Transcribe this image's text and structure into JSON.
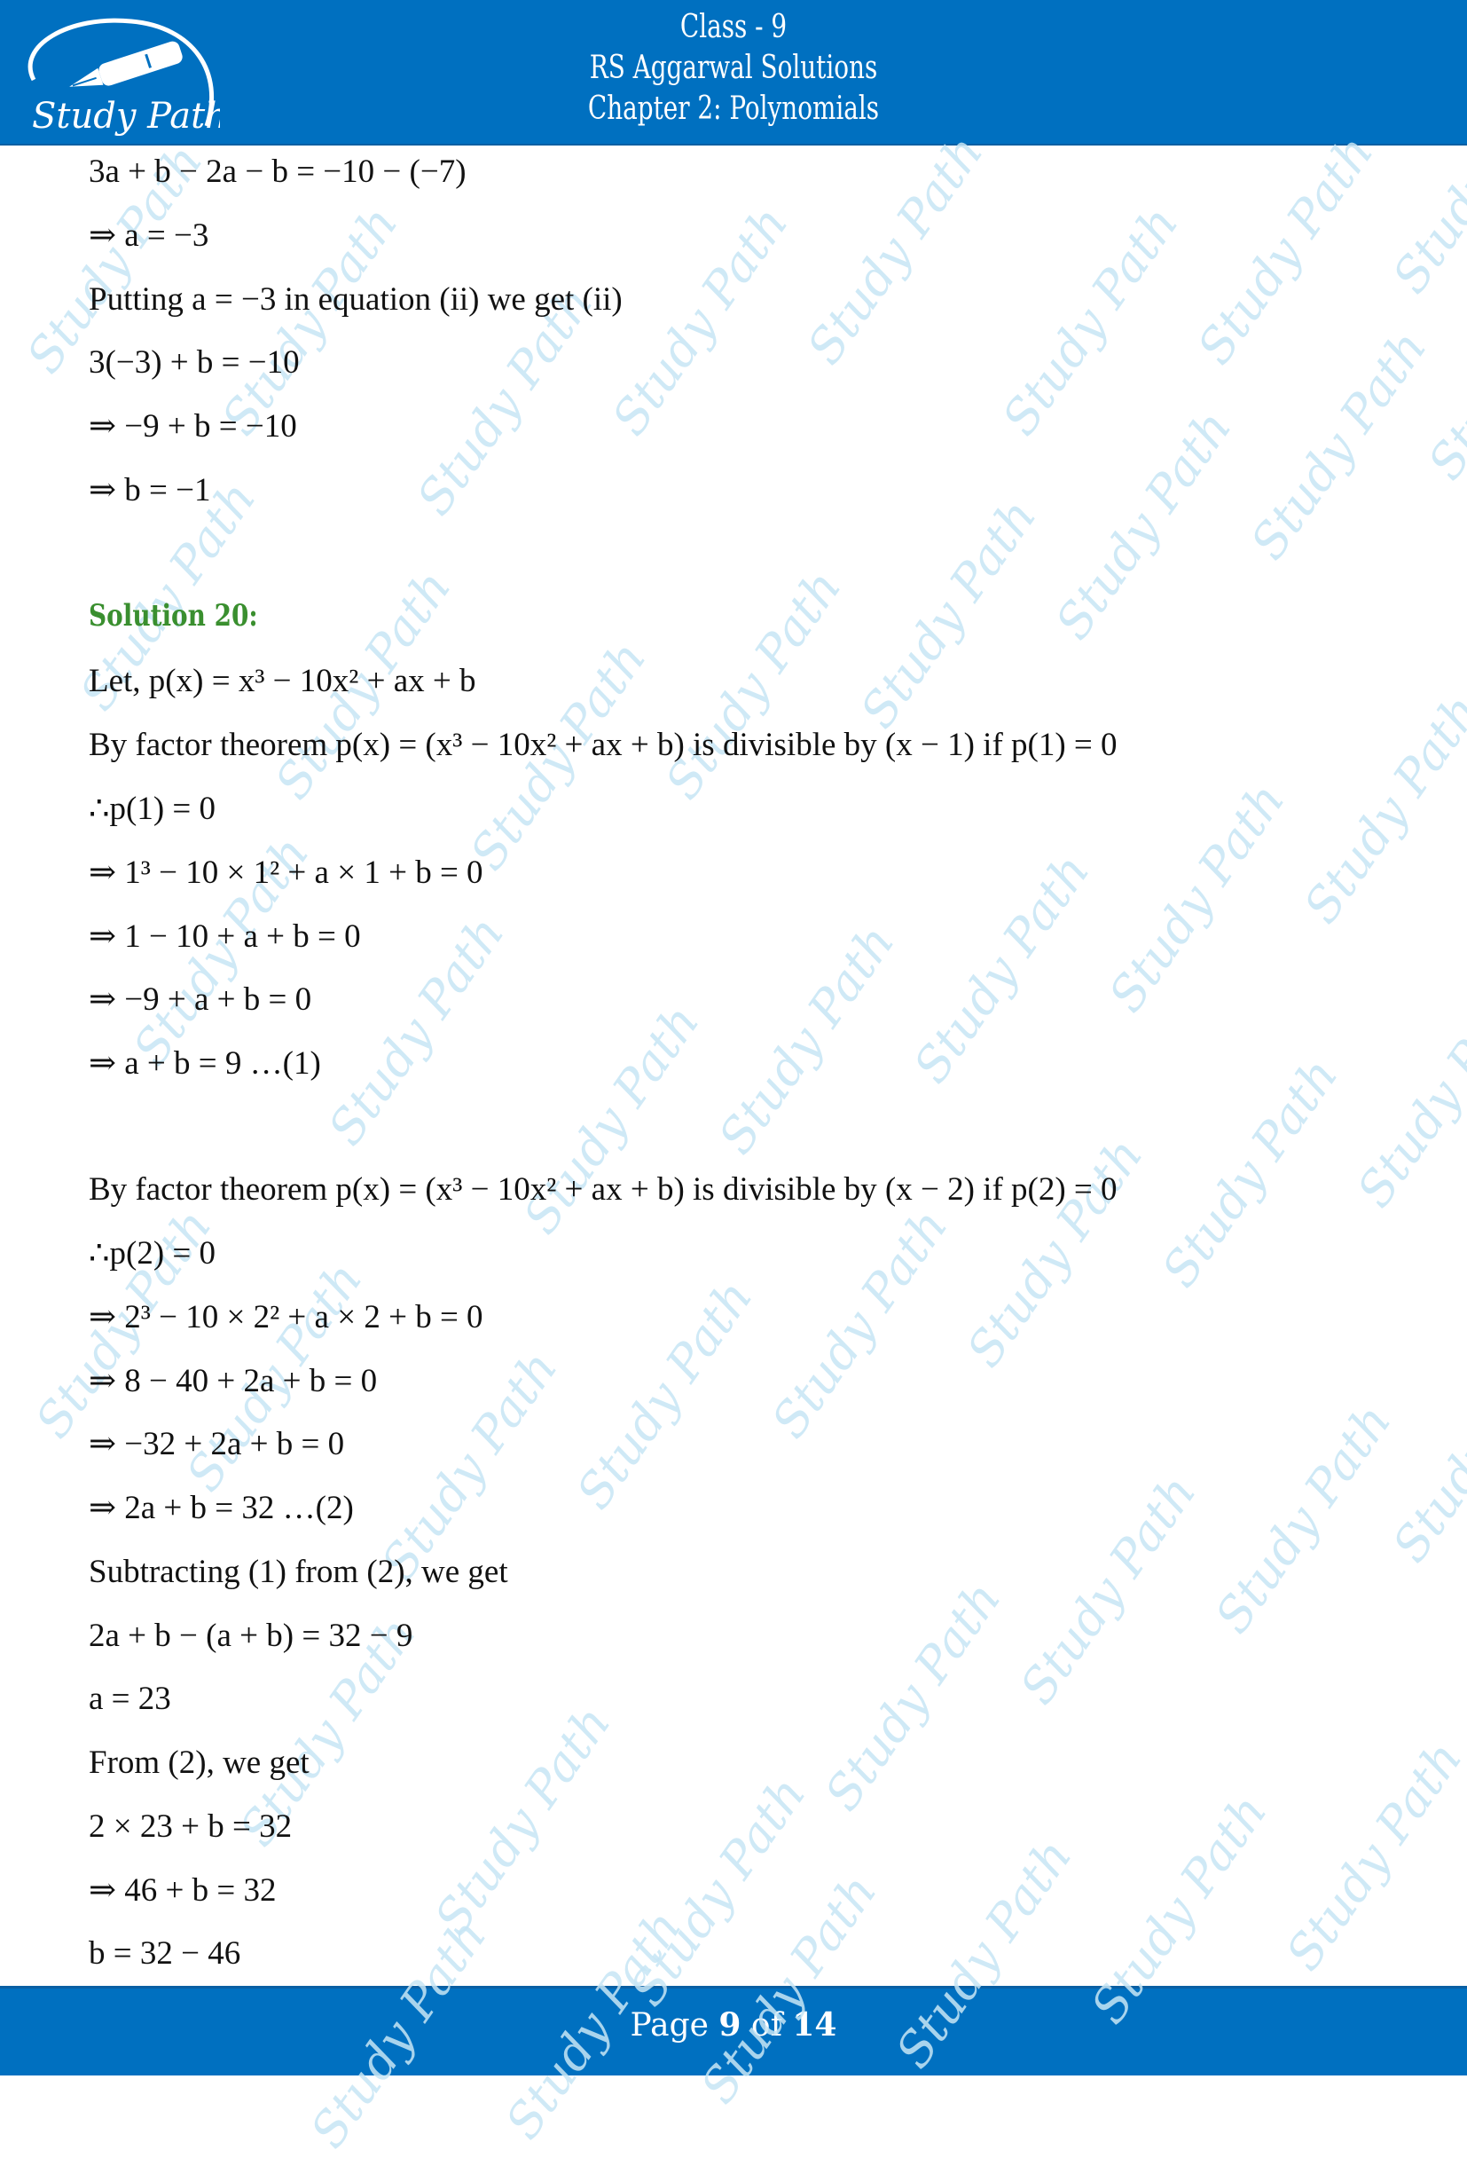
{
  "header": {
    "logo_text": "Study Path",
    "class_label": "Class - 9",
    "book_title": "RS Aggarwal Solutions",
    "chapter_title": "Chapter 2: Polynomials",
    "background_color": "#0070c0"
  },
  "watermark_text": "Study Path",
  "content": {
    "prev_solution_lines": [
      "3a + b − 2a − b = −10 − (−7)",
      "⇒ a = −3",
      "Putting a = −3 in equation (ii) we get (ii)",
      "3(−3) + b = −10",
      "⇒ −9 + b = −10",
      "⇒ b = −1"
    ],
    "solution_title": "Solution 20:",
    "solution_title_color": "#3a8f2f",
    "lines": [
      "Let, p(x) = x³ − 10x² + ax + b",
      "By factor theorem p(x) = (x³ − 10x² + ax + b) is divisible by (x − 1) if p(1) = 0",
      "∴p(1) = 0",
      "⇒ 1³ − 10 × 1² + a × 1 + b = 0",
      "⇒ 1 − 10 + a + b = 0",
      "⇒ −9 + a + b = 0",
      "⇒ a + b = 9        …(1)",
      "By factor theorem p(x) = (x³ − 10x² + ax + b) is divisible by (x − 2) if p(2) = 0",
      "∴p(2) = 0",
      "⇒ 2³ − 10 × 2² + a × 2 + b = 0",
      "⇒ 8 − 40 + 2a + b = 0",
      "⇒ −32 + 2a + b = 0",
      "⇒ 2a + b = 32        …(2)",
      "Subtracting (1) from (2), we get",
      "2a + b − (a + b) = 32 − 9",
      "a = 23",
      "From (2), we get",
      "2 × 23 + b = 32",
      "⇒ 46 + b = 32",
      "b = 32 − 46"
    ]
  },
  "footer": {
    "page_prefix": "Page",
    "current_page": "9",
    "of_label": "of",
    "total_pages": "14"
  }
}
